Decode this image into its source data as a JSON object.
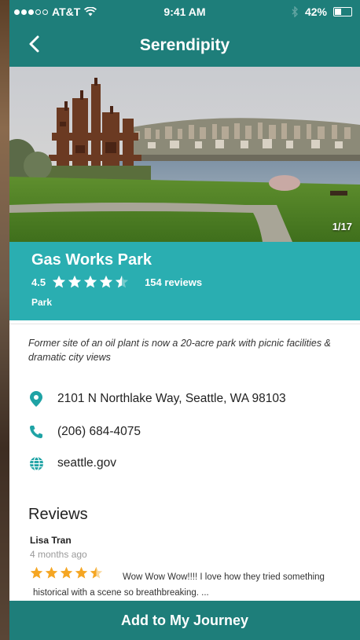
{
  "status_bar": {
    "carrier": "AT&T",
    "time": "9:41 AM",
    "battery": "42%",
    "battery_level": 0.42
  },
  "nav": {
    "title": "Serendipity",
    "back_icon": "chevron-left-icon"
  },
  "hero": {
    "photo_counter": "1/17"
  },
  "place": {
    "name": "Gas Works Park",
    "rating": "4.5",
    "rating_value": 4.5,
    "reviews_count": "154 reviews",
    "category": "Park"
  },
  "details": {
    "description": "Former site of an oil plant is now a 20-acre park with picnic facilities & dramatic city views",
    "address": "2101 N Northlake Way, Seattle, WA 98103",
    "phone": "(206) 684-4075",
    "website": "seattle.gov"
  },
  "reviews": {
    "heading": "Reviews",
    "items": [
      {
        "author": "Lisa Tran",
        "date": "4 months ago",
        "rating_value": 4.5,
        "text": "Wow Wow Wow!!!! I love how they tried something historical with a scene so breathbreaking. ..."
      }
    ]
  },
  "cta": {
    "label": "Add to My Journey"
  },
  "colors": {
    "primary_dark": "#1e7e7a",
    "primary": "#2aaeb1",
    "icon": "#1fa3a5",
    "star_review": "#f5a623"
  }
}
